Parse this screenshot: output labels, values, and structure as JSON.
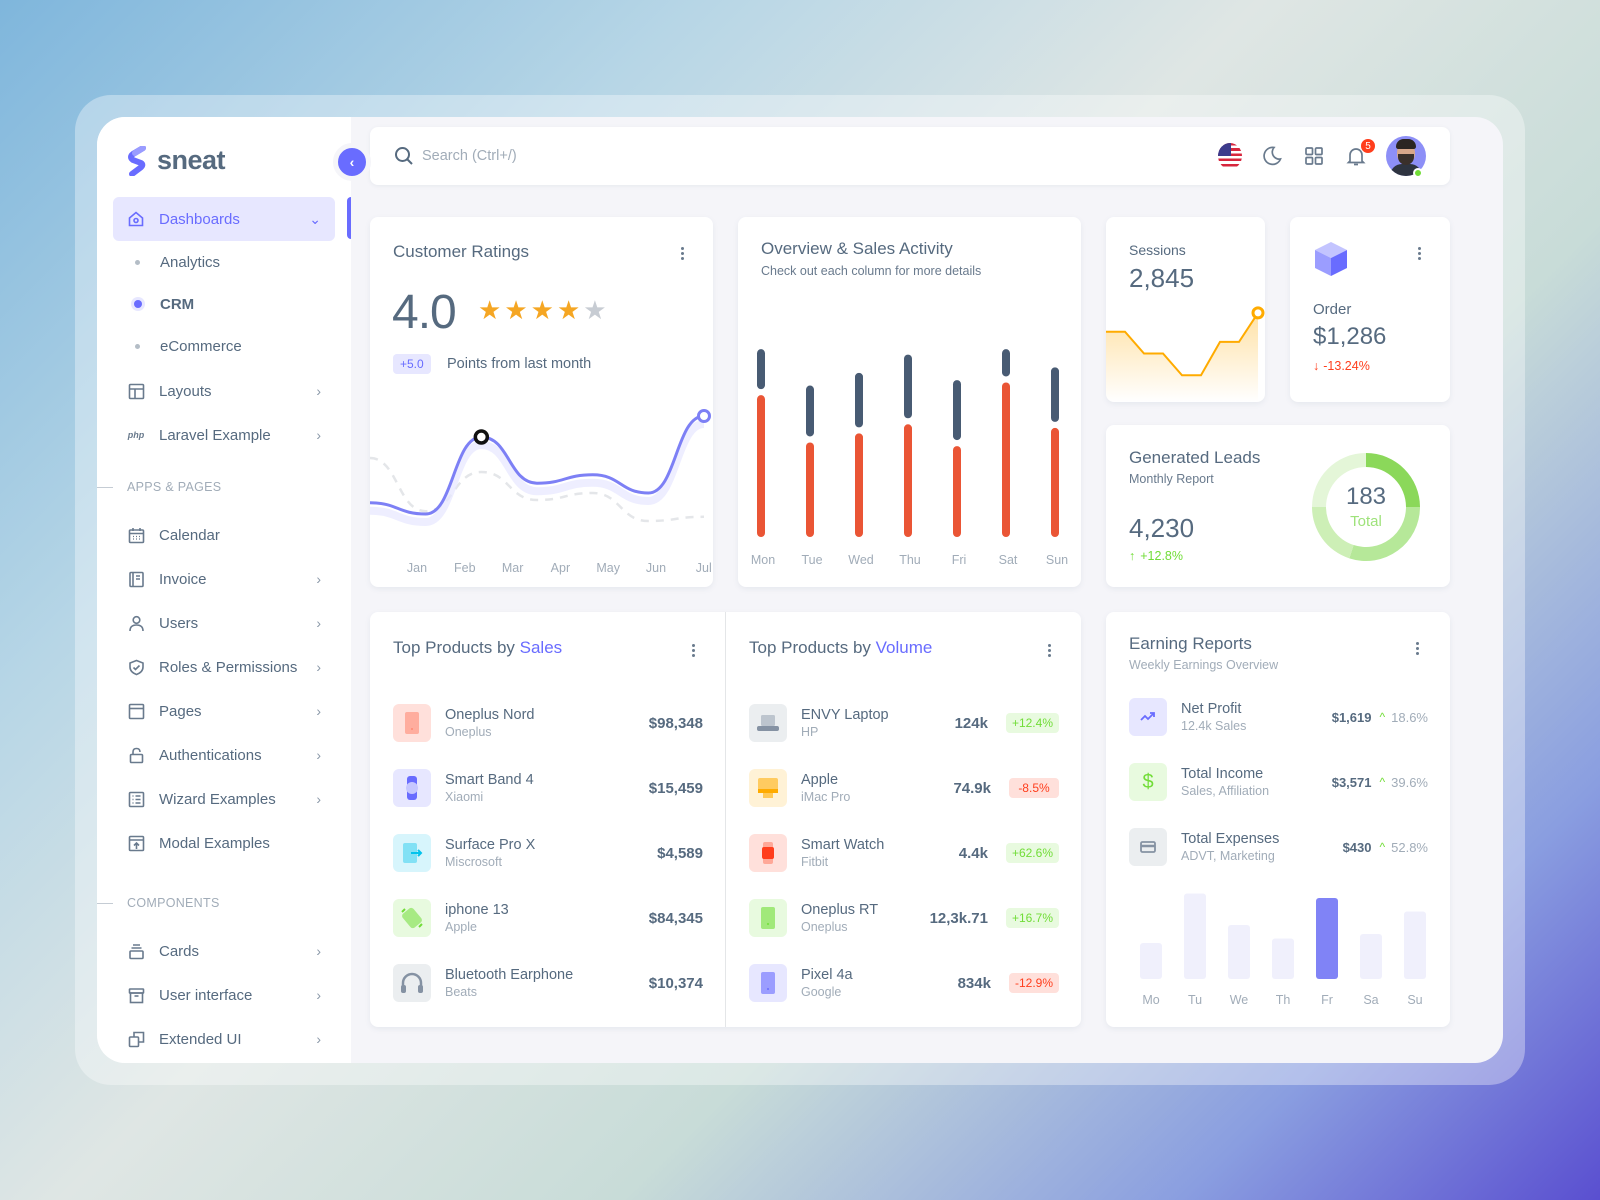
{
  "brand": {
    "name": "sneat",
    "accent": "#696cff"
  },
  "sidebar": {
    "dashboards": {
      "label": "Dashboards",
      "children": [
        {
          "label": "Analytics",
          "active": false
        },
        {
          "label": "CRM",
          "active": true
        },
        {
          "label": "eCommerce",
          "active": false
        }
      ]
    },
    "top_items": [
      {
        "label": "Layouts",
        "icon": "layout-icon"
      },
      {
        "label": "Laravel Example",
        "icon": "php-icon"
      }
    ],
    "apps_header": "APPS & PAGES",
    "apps_items": [
      {
        "label": "Calendar",
        "icon": "calendar-icon",
        "has_children": false
      },
      {
        "label": "Invoice",
        "icon": "invoice-icon",
        "has_children": true
      },
      {
        "label": "Users",
        "icon": "user-icon",
        "has_children": true
      },
      {
        "label": "Roles & Permissions",
        "icon": "shield-check-icon",
        "has_children": true
      },
      {
        "label": "Pages",
        "icon": "page-icon",
        "has_children": true
      },
      {
        "label": "Authentications",
        "icon": "lock-icon",
        "has_children": true
      },
      {
        "label": "Wizard Examples",
        "icon": "list-icon",
        "has_children": true
      },
      {
        "label": "Modal Examples",
        "icon": "window-icon",
        "has_children": false
      }
    ],
    "components_header": "COMPONENTS",
    "components_items": [
      {
        "label": "Cards",
        "icon": "cards-icon"
      },
      {
        "label": "User interface",
        "icon": "archive-icon"
      },
      {
        "label": "Extended UI",
        "icon": "copy-icon"
      }
    ]
  },
  "topbar": {
    "search_placeholder": "Search (Ctrl+/)",
    "notification_count": "5",
    "language": "en-US flag"
  },
  "customer_ratings": {
    "title": "Customer Ratings",
    "rating": "4.0",
    "stars_filled": 4,
    "stars_total": 5,
    "change_badge": "+5.0",
    "change_text": "Points from last month",
    "chart_data": {
      "type": "line",
      "x": [
        "Jan",
        "Feb",
        "Mar",
        "Apr",
        "May",
        "Jun",
        "Jul"
      ],
      "series": [
        {
          "name": "current",
          "values": [
            28,
            20,
            75,
            42,
            48,
            35,
            90
          ]
        },
        {
          "name": "previous",
          "values": [
            60,
            22,
            50,
            30,
            35,
            15,
            18
          ]
        }
      ],
      "highlighted_point": "Mar",
      "ylim": [
        0,
        100
      ]
    }
  },
  "sales_activity": {
    "title": "Overview & Sales Activity",
    "subtitle": "Check out each column for more details",
    "chart_data": {
      "type": "bar",
      "stacked": true,
      "categories": [
        "Mon",
        "Tue",
        "Wed",
        "Thu",
        "Fri",
        "Sat",
        "Sun"
      ],
      "series": [
        {
          "name": "primary",
          "color": "#ea5535",
          "values": [
            78,
            52,
            57,
            62,
            50,
            85,
            60
          ]
        },
        {
          "name": "secondary",
          "color": "#485b73",
          "values": [
            22,
            28,
            30,
            35,
            33,
            15,
            30
          ]
        }
      ],
      "ylim": [
        0,
        110
      ]
    }
  },
  "sessions": {
    "label": "Sessions",
    "value": "2,845",
    "chart_data": {
      "type": "area",
      "values": [
        45,
        45,
        30,
        30,
        15,
        15,
        38,
        38,
        58
      ],
      "color": "#ffab00"
    }
  },
  "order": {
    "label": "Order",
    "value": "$1,286",
    "change": "-13.24%"
  },
  "generated_leads": {
    "title": "Generated Leads",
    "subtitle": "Monthly Report",
    "value": "4,230",
    "change": "+12.8%",
    "donut_total": "183",
    "donut_label": "Total",
    "chart_data": {
      "type": "pie",
      "values": [
        25,
        30,
        20,
        25
      ],
      "colors": [
        "#8bd85a",
        "#b6e899",
        "#cdefb6",
        "#e4f6d8"
      ]
    }
  },
  "top_sales": {
    "title_prefix": "Top Products by",
    "title_highlight": "Sales",
    "items": [
      {
        "name": "Oneplus Nord",
        "brand": "Oneplus",
        "value": "$98,348",
        "icon": "phone-icon",
        "bg": "#ffe0db",
        "fg": "#ff8a75"
      },
      {
        "name": "Smart Band 4",
        "brand": "Xiaomi",
        "value": "$15,459",
        "icon": "smart-band-icon",
        "bg": "#e7e7ff",
        "fg": "#696cff"
      },
      {
        "name": "Surface Pro X",
        "brand": "Miscrosoft",
        "value": "$4,589",
        "icon": "tablet-icon",
        "bg": "#d7f5fc",
        "fg": "#03c3ec"
      },
      {
        "name": "iphone 13",
        "brand": "Apple",
        "value": "$84,345",
        "icon": "iphone-icon",
        "bg": "#e8fadf",
        "fg": "#71dd37"
      },
      {
        "name": "Bluetooth Earphone",
        "brand": "Beats",
        "value": "$10,374",
        "icon": "headphones-icon",
        "bg": "#ebeef0",
        "fg": "#8592a3"
      }
    ]
  },
  "top_volume": {
    "title_prefix": "Top Products by",
    "title_highlight": "Volume",
    "items": [
      {
        "name": "ENVY Laptop",
        "brand": "HP",
        "value": "124k",
        "change": "+12.4%",
        "trend": "up",
        "icon": "laptop-icon",
        "bg": "#ebeef0",
        "fg": "#8592a3"
      },
      {
        "name": "Apple",
        "brand": "iMac Pro",
        "value": "74.9k",
        "change": "-8.5%",
        "trend": "down",
        "icon": "monitor-icon",
        "bg": "#fff2d6",
        "fg": "#ffab00"
      },
      {
        "name": "Smart Watch",
        "brand": "Fitbit",
        "value": "4.4k",
        "change": "+62.6%",
        "trend": "up",
        "icon": "watch-icon",
        "bg": "#ffe0db",
        "fg": "#ff3e1d"
      },
      {
        "name": "Oneplus RT",
        "brand": "Oneplus",
        "value": "12,3k.71",
        "change": "+16.7%",
        "trend": "up",
        "icon": "phone-icon",
        "bg": "#e8fadf",
        "fg": "#71dd37"
      },
      {
        "name": "Pixel 4a",
        "brand": "Google",
        "value": "834k",
        "change": "-12.9%",
        "trend": "down",
        "icon": "phone-icon",
        "bg": "#e7e7ff",
        "fg": "#696cff"
      }
    ]
  },
  "earning_reports": {
    "title": "Earning Reports",
    "subtitle": "Weekly Earnings Overview",
    "items": [
      {
        "name": "Net Profit",
        "sub": "12.4k Sales",
        "value": "$1,619",
        "pct": "18.6%",
        "icon": "trending-up-icon",
        "bg": "#e7e7ff",
        "fg": "#696cff"
      },
      {
        "name": "Total Income",
        "sub": "Sales, Affiliation",
        "value": "$3,571",
        "pct": "39.6%",
        "icon": "dollar-icon",
        "bg": "#e8fadf",
        "fg": "#71dd37"
      },
      {
        "name": "Total Expenses",
        "sub": "ADVT, Marketing",
        "value": "$430",
        "pct": "52.8%",
        "icon": "credit-card-icon",
        "bg": "#ebeef0",
        "fg": "#8592a3"
      }
    ],
    "chart_data": {
      "type": "bar",
      "categories": [
        "Mo",
        "Tu",
        "We",
        "Th",
        "Fr",
        "Sa",
        "Su"
      ],
      "values": [
        40,
        95,
        60,
        45,
        90,
        50,
        75
      ],
      "highlight": "Fr",
      "ylim": [
        0,
        100
      ]
    }
  }
}
